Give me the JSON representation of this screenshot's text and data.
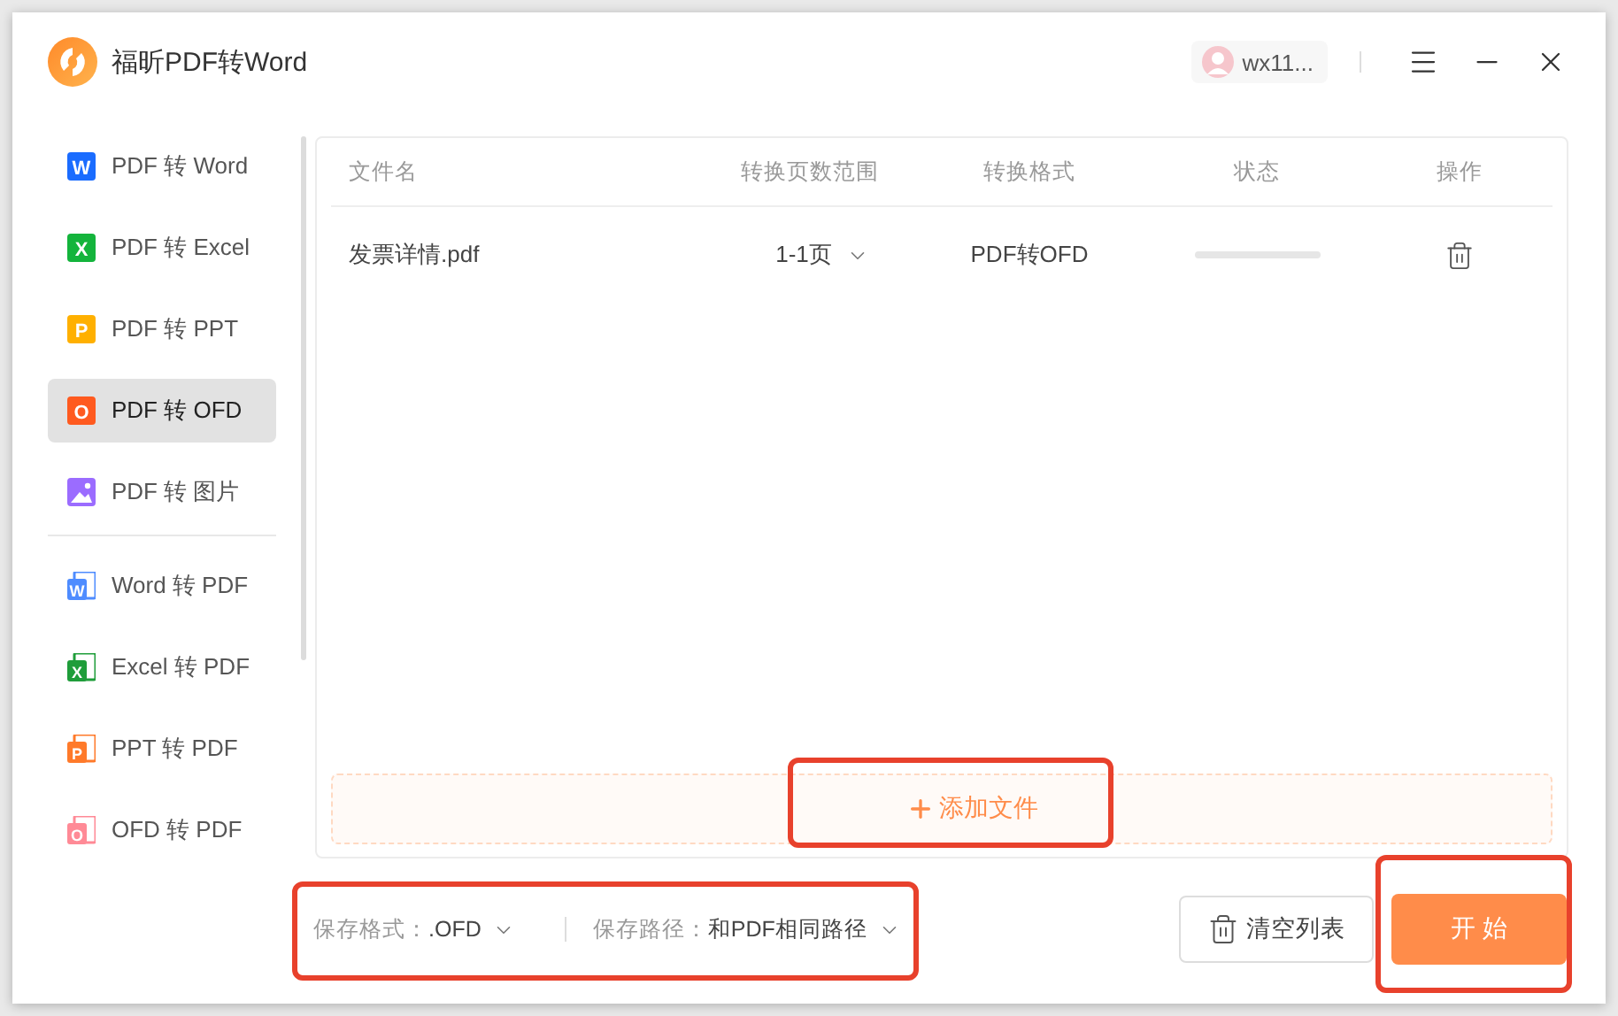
{
  "app": {
    "title": "福昕PDF转Word"
  },
  "account": {
    "name": "wx11..."
  },
  "sidebar": {
    "groups": [
      {
        "items": [
          {
            "label": "PDF 转 Word",
            "kind": "badge",
            "letter": "W",
            "color": "#1a6cff",
            "selected": false
          },
          {
            "label": "PDF 转 Excel",
            "kind": "badge",
            "letter": "X",
            "color": "#14b43c",
            "selected": false
          },
          {
            "label": "PDF 转 PPT",
            "kind": "badge",
            "letter": "P",
            "color": "#ffb000",
            "selected": false
          },
          {
            "label": "PDF 转 OFD",
            "kind": "badge",
            "letter": "O",
            "color": "#ff5a1f",
            "selected": true
          },
          {
            "label": "PDF 转 图片",
            "kind": "image",
            "color": "#9b6cff",
            "selected": false
          }
        ]
      },
      {
        "items": [
          {
            "label": "Word 转 PDF",
            "kind": "doc",
            "letter": "W",
            "color": "#4e8cff",
            "selected": false
          },
          {
            "label": "Excel 转 PDF",
            "kind": "doc",
            "letter": "X",
            "color": "#1f9d3a",
            "selected": false
          },
          {
            "label": "PPT 转 PDF",
            "kind": "doc",
            "letter": "P",
            "color": "#ff7a2a",
            "selected": false
          },
          {
            "label": "OFD 转 PDF",
            "kind": "doc",
            "letter": "O",
            "color": "#ff8a96",
            "selected": false
          }
        ]
      }
    ]
  },
  "table": {
    "columns": [
      "文件名",
      "转换页数范围",
      "转换格式",
      "状态",
      "操作"
    ],
    "rows": [
      {
        "file_name": "发票详情.pdf",
        "page_range": "1-1页",
        "format": "PDF转OFD",
        "level": 0
      }
    ]
  },
  "add_file": {
    "label": "添加文件",
    "highlighted": true
  },
  "save_options": {
    "highlighted": true,
    "format": {
      "label": "保存格式：",
      "value": ".OFD"
    },
    "path": {
      "label": "保存路径：",
      "value": "和PDF相同路径"
    }
  },
  "buttons": {
    "clear": {
      "label": "清空列表"
    },
    "start": {
      "label": "开 始",
      "highlighted": true
    }
  }
}
